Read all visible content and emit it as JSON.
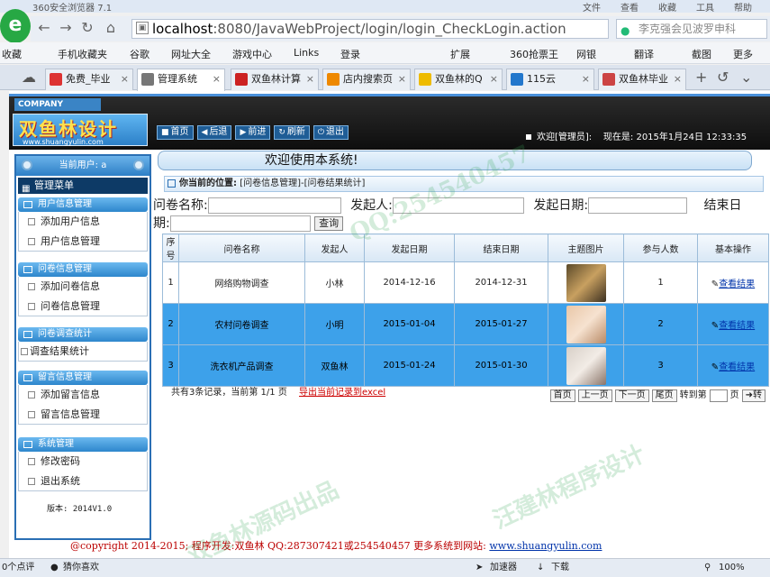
{
  "browser": {
    "window_title": "360安全浏览器 7.1",
    "menus": [
      "文件",
      "查看",
      "收藏",
      "工具",
      "帮助"
    ],
    "url_host": "localhost",
    "url_path": ":8080/JavaWebProject/login/login_CheckLogin.action",
    "search_text": "李克强会见波罗申科",
    "favorites": [
      "收藏",
      "手机收藏夹",
      "谷歌",
      "网址大全",
      "游戏中心",
      "Links",
      "登录",
      "扩展",
      "360抢票王",
      "网银",
      "翻译",
      "截图",
      "更多"
    ],
    "tabs": [
      "免费_毕业",
      "管理系统",
      "双鱼林计算",
      "店内搜索页",
      "双鱼林的Q",
      "115云",
      "双鱼林毕业"
    ]
  },
  "header": {
    "company": "COMPANY",
    "brand_cn": "双鱼林设计",
    "brand_en": "www.shuangyulin.com",
    "nav_buttons": [
      "首页",
      "后退",
      "前进",
      "刷新",
      "退出"
    ],
    "welcome_user": "欢迎[管理员]:",
    "now_label": "现在是:",
    "now_value": "2015年1月24日  12:33:35"
  },
  "welcome_bar": "欢迎使用本系统!",
  "sidebar": {
    "user_label": "当前用户: a",
    "main_menu": "管理菜单",
    "groups": [
      {
        "title": "用户信息管理",
        "items": [
          "添加用户信息",
          "用户信息管理"
        ]
      },
      {
        "title": "问卷信息管理",
        "items": [
          "添加问卷信息",
          "问卷信息管理"
        ]
      },
      {
        "title": "问卷调查统计",
        "items": [
          "调查结果统计"
        ]
      },
      {
        "title": "留言信息管理",
        "items": [
          "添加留言信息",
          "留言信息管理"
        ]
      },
      {
        "title": "系统管理",
        "items": [
          "修改密码",
          "退出系统"
        ]
      }
    ],
    "version": "版本: 2014V1.0"
  },
  "content": {
    "position_label": "你当前的位置:",
    "position_path": "[问卷信息管理]-[问卷结果统计]",
    "filter": {
      "name_label": "问卷名称:",
      "initiator_label": "发起人:",
      "start_label": "发起日期:",
      "end_label_1": "结束日",
      "end_label_2": "期:",
      "query_button": "查询"
    },
    "table": {
      "headers": [
        "序号",
        "问卷名称",
        "发起人",
        "发起日期",
        "结束日期",
        "主题图片",
        "参与人数",
        "基本操作"
      ],
      "rows": [
        {
          "no": "1",
          "name": "网络购物调查",
          "initiator": "小林",
          "start": "2014-12-16",
          "end": "2014-12-31",
          "count": "1",
          "op": "查看结果"
        },
        {
          "no": "2",
          "name": "农村问卷调查",
          "initiator": "小明",
          "start": "2015-01-04",
          "end": "2015-01-27",
          "count": "2",
          "op": "查看结果"
        },
        {
          "no": "3",
          "name": "洗衣机产品调查",
          "initiator": "双鱼林",
          "start": "2015-01-24",
          "end": "2015-01-30",
          "count": "3",
          "op": "查看结果"
        }
      ]
    },
    "pager": {
      "summary": "共有3条记录，当前第 1/1 页",
      "export": "导出当前记录到excel",
      "buttons": [
        "首页",
        "上一页",
        "下一页",
        "尾页"
      ],
      "goto_label": "转到第",
      "page_unit": "页",
      "goto_button": "转"
    }
  },
  "footer": {
    "text": "@copyright 2014-2015; 程序开发:双鱼林  QQ:287307421或254540457  更多系统到网站:",
    "link": "www.shuangyulin.com"
  },
  "statusbar": {
    "left": "0个点评",
    "guess": "猜你喜欢",
    "accelerator": "加速器",
    "download": "下载",
    "zoom": "100%"
  },
  "watermarks": [
    "双鱼林源码出品",
    "汪建林程序设计",
    "QQ:254540457"
  ]
}
